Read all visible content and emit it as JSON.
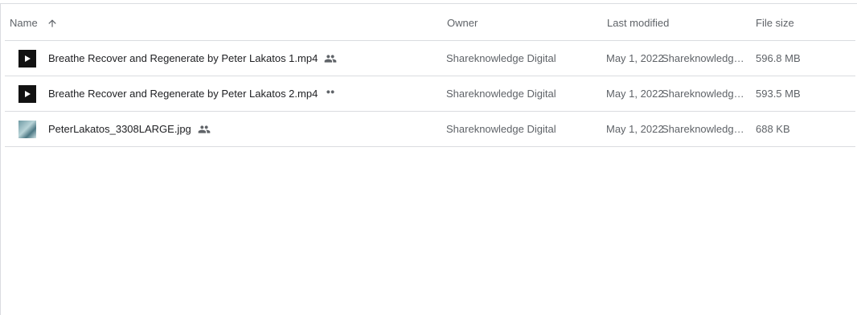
{
  "header": {
    "name": "Name",
    "owner": "Owner",
    "last_modified": "Last modified",
    "file_size": "File size",
    "sort_icon": "arrow-up-icon"
  },
  "files": [
    {
      "name": "Breathe Recover and Regenerate by Peter Lakatos 1.mp4",
      "type": "video",
      "shared_icon": "people-icon",
      "owner": "Shareknowledge Digital",
      "modified_date": "May 1, 2022",
      "modified_by": "Shareknowledge Digital",
      "size": "596.8 MB"
    },
    {
      "name": "Breathe Recover and Regenerate by Peter Lakatos 2.mp4",
      "type": "video",
      "shared_icon": "people-icon",
      "owner": "Shareknowledge Digital",
      "modified_date": "May 1, 2022",
      "modified_by": "Shareknowledge Digital",
      "size": "593.5 MB"
    },
    {
      "name": "PeterLakatos_3308LARGE.jpg",
      "type": "image",
      "shared_icon": "people-icon",
      "owner": "Shareknowledge Digital",
      "modified_date": "May 1, 2022",
      "modified_by": "Shareknowledge Digital",
      "size": "688 KB"
    }
  ]
}
